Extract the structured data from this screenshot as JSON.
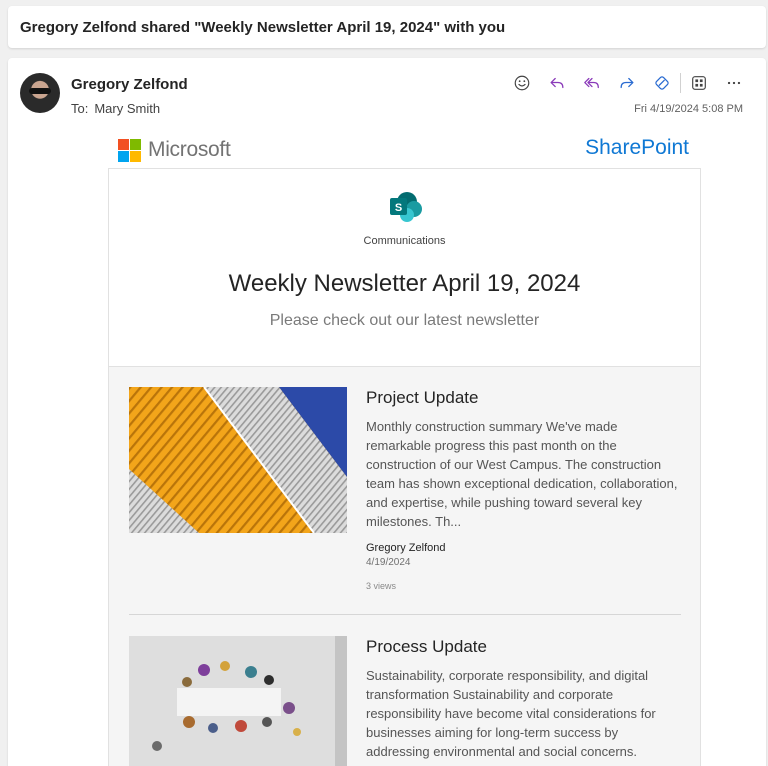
{
  "subject": "Gregory Zelfond shared \"Weekly Newsletter April 19, 2024\" with you",
  "message": {
    "sender": "Gregory Zelfond",
    "to_label": "To:",
    "recipient": "Mary Smith",
    "date": "Fri 4/19/2024 5:08 PM",
    "actions": [
      "smile-icon",
      "reply-icon",
      "reply-all-icon",
      "forward-icon",
      "loop-icon",
      "apps-icon",
      "more-icon"
    ]
  },
  "email_header": {
    "microsoft_wordmark": "Microsoft",
    "sharepoint_wordmark": "SharePoint",
    "microsoft_colors": [
      "#f25022",
      "#7fba00",
      "#00a4ef",
      "#ffb900"
    ]
  },
  "newsletter": {
    "site_name": "Communications",
    "title": "Weekly Newsletter April 19, 2024",
    "subtitle": "Please check out our latest newsletter",
    "articles": [
      {
        "title": "Project Update",
        "description": "Monthly construction summary We've made remarkable progress this past month on the construction of our West Campus. The construction team has shown exceptional dedication, collaboration, and expertise, while pushing toward several key milestones. Th...",
        "author": "Gregory Zelfond",
        "date": "4/19/2024",
        "views": "3 views"
      },
      {
        "title": "Process Update",
        "description": "Sustainability, corporate responsibility, and digital transformation Sustainability and corporate responsibility have become vital considerations for businesses aiming for long-term success by addressing environmental and social concerns."
      }
    ]
  },
  "colors": {
    "accent_purple": "#8a3ab9",
    "loop_blue": "#2a6bd1",
    "sharepoint_blue": "#0f78d4",
    "sharepoint_teal": "#03787c"
  }
}
